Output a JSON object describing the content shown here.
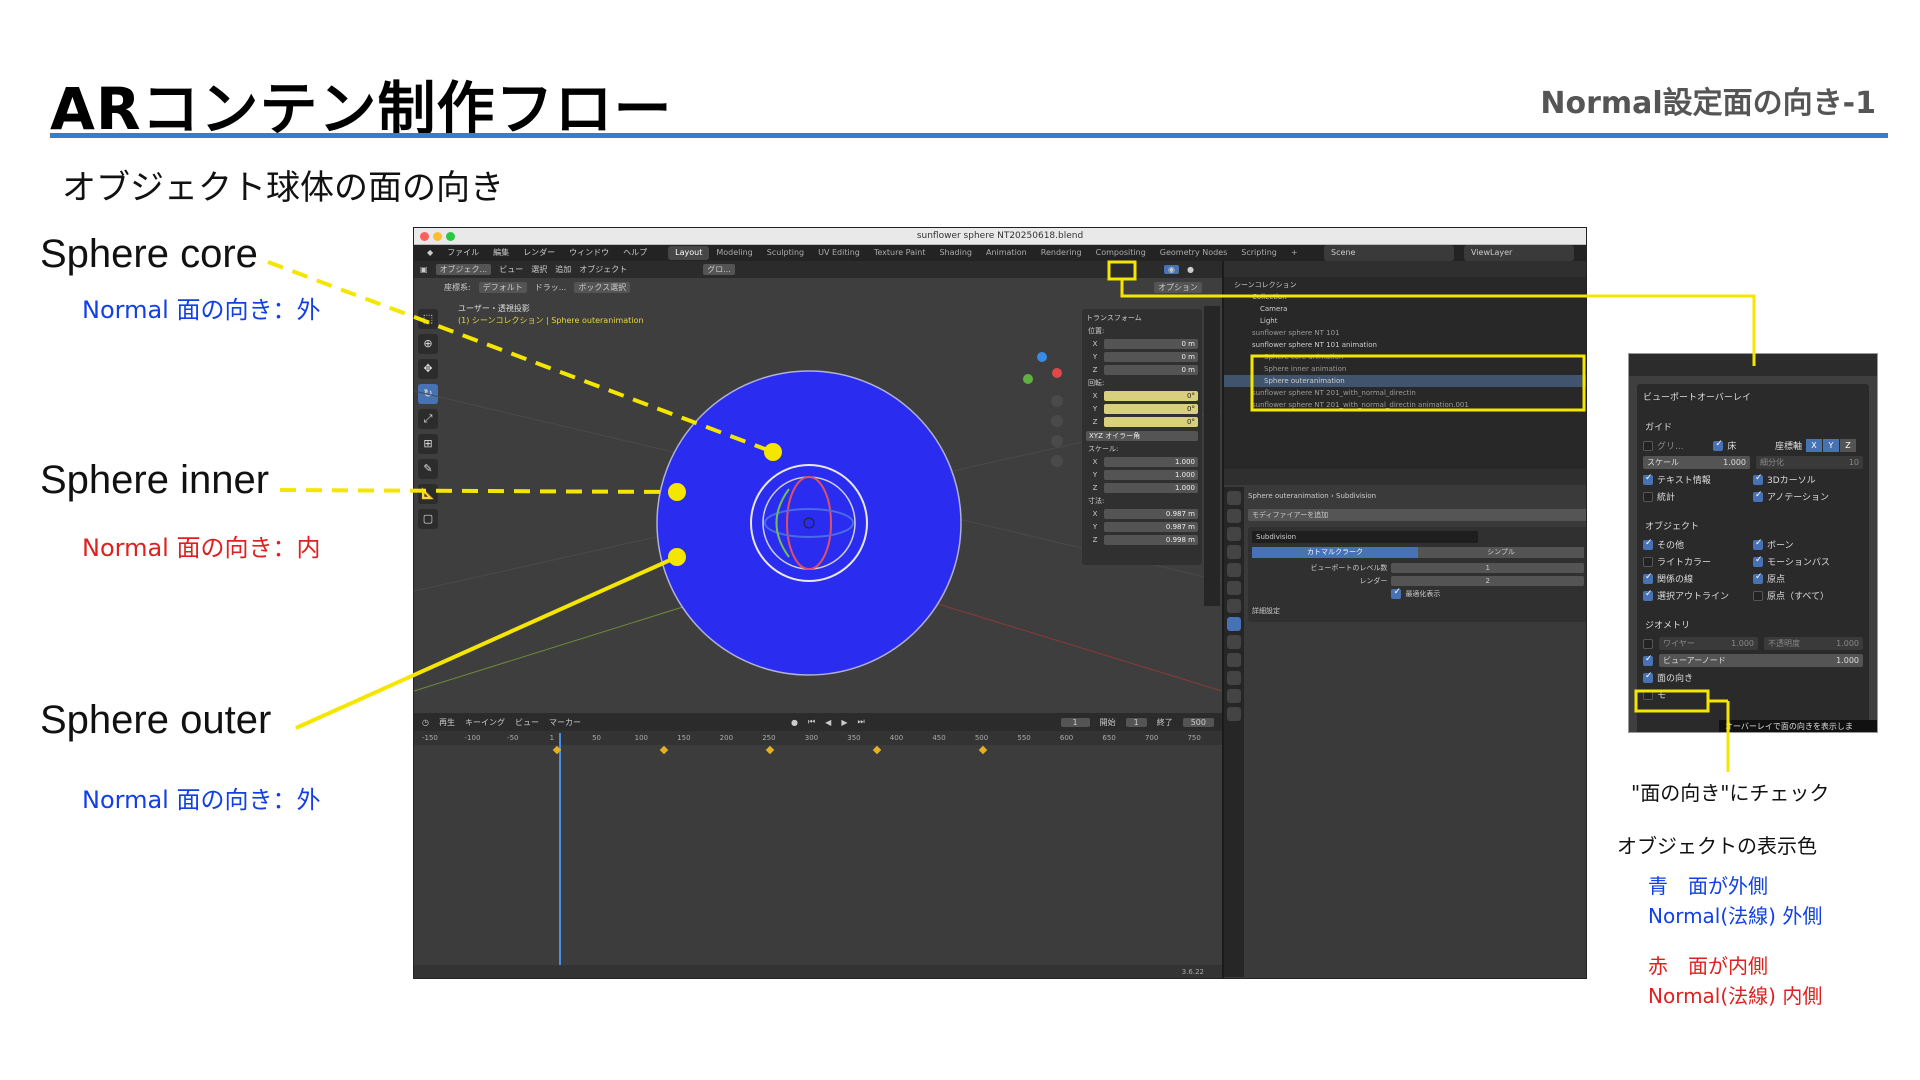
{
  "slide": {
    "title": "ARコンテン制作フロー",
    "subtitle": "Normal設定面の向き-1",
    "section_heading": "オブジェクト球体の面の向き"
  },
  "callouts": [
    {
      "title": "Sphere core",
      "note": "Normal 面の向き：外",
      "color": "#1240e6"
    },
    {
      "title": "Sphere inner",
      "note": "Normal 面の向き：内",
      "color": "#e02020"
    },
    {
      "title": "Sphere outer",
      "note": "Normal 面の向き：外",
      "color": "#1240e6"
    }
  ],
  "blender": {
    "window_title": "sunflower sphere NT20250618.blend",
    "menu": [
      "ファイル",
      "編集",
      "レンダー",
      "ウィンドウ",
      "ヘルプ"
    ],
    "workspaces": [
      "Layout",
      "Modeling",
      "Sculpting",
      "UV Editing",
      "Texture Paint",
      "Shading",
      "Animation",
      "Rendering",
      "Compositing",
      "Geometry Nodes",
      "Scripting"
    ],
    "scene": "Scene",
    "view_layer": "ViewLayer",
    "viewport": {
      "mode": "オブジェク...",
      "header_items": [
        "ビュー",
        "選択",
        "追加",
        "オブジェクト"
      ],
      "orientation": "グロ...",
      "coord_label": "座標系:",
      "coord_value": "デフォルト",
      "drag": "ドラッ...",
      "select_mode": "ボックス選択",
      "options": "オプション",
      "view_name": "ユーザー・透視投影",
      "collection_path": "(1) シーンコレクション | Sphere outeranimation"
    },
    "transform_panel": {
      "title": "トランスフォーム",
      "location_label": "位置:",
      "location": [
        "0 m",
        "0 m",
        "0 m"
      ],
      "rotation_label": "回転:",
      "rotation": [
        "0°",
        "0°",
        "0°"
      ],
      "rotation_mode": "XYZ オイラー角",
      "scale_label": "スケール:",
      "scale": [
        "1.000",
        "1.000",
        "1.000"
      ],
      "dimensions_label": "寸法:",
      "dimensions": [
        "0.987 m",
        "0.987 m",
        "0.998 m"
      ],
      "axes": [
        "X",
        "Y",
        "Z"
      ]
    },
    "timeline": {
      "playback": "再生",
      "keying": "キーイング",
      "view": "ビュー",
      "marker": "マーカー",
      "current_frame": "1",
      "start_label": "開始",
      "start": "1",
      "end_label": "終了",
      "end": "500",
      "frame_labels": [
        "-150",
        "-100",
        "-50",
        "1",
        "50",
        "100",
        "150",
        "200",
        "250",
        "300",
        "350",
        "400",
        "450",
        "500",
        "550",
        "600",
        "650",
        "700",
        "750"
      ],
      "version": "3.6.22"
    },
    "outliner": {
      "root": "シーンコレクション",
      "rows": [
        "Collection",
        "Camera",
        "Light",
        "sunflower sphere NT 101",
        "sunflower sphere NT 101 animation",
        "Sphere core animation",
        "Sphere inner animation",
        "Sphere outeranimation",
        "sunflower sphere NT 201_with_normal_directin",
        "sunflower sphere NT 201_with_normal_directin animation.001"
      ]
    },
    "properties": {
      "object": "Sphere outeranimation",
      "modifier_crumb": "Subdivision",
      "add_modifier": "モディファイアーを追加",
      "modifier_name": "Subdivision",
      "mode_a": "カトマルクラーク",
      "mode_b": "シンプル",
      "levels_viewport_label": "ビューポートのレベル数",
      "levels_viewport": "1",
      "render_label": "レンダー",
      "render": "2",
      "optimal_display": "最適化表示",
      "advanced": "詳細設定"
    }
  },
  "overlay_popup": {
    "title": "ビューポートオーバーレイ",
    "guides": "ガイド",
    "grid": "グリ...",
    "floor": "床",
    "axes_label": "座標軸",
    "axes": [
      "X",
      "Y",
      "Z"
    ],
    "scale_label": "スケール",
    "scale_value": "1.000",
    "subdivision_label": "細分化",
    "subdivision_value": "10",
    "text_info": "テキスト情報",
    "cursor_3d": "3Dカーソル",
    "statistics": "統計",
    "annotations": "アノテーション",
    "objects": "オブジェクト",
    "extras": "その他",
    "bones": "ボーン",
    "light_colors": "ライトカラー",
    "motion_paths": "モーションパス",
    "relations": "関係の線",
    "origins": "原点",
    "outline_selected": "選択アウトライン",
    "origins_all": "原点（すべて）",
    "geometry": "ジオメトリ",
    "wireframe": "ワイヤー",
    "wireframe_value": "1.000",
    "opacity": "不透明度",
    "opacity_value": "1.000",
    "viewer_node": "ビューアーノード",
    "viewer_node_value": "1.000",
    "face_orientation": "面の向き",
    "tooltip": "オーバーレイで面の向きを表示しま",
    "cut_label": "モ"
  },
  "check_note": "\"面の向き\"にチェック",
  "legend": {
    "heading": "オブジェクトの表示色",
    "blue_line1": "青　面が外側",
    "blue_line2": "Normal(法線) 外側",
    "red_line1": "赤　面が内側",
    "red_line2": "Normal(法線) 内側",
    "blue": "#1240e6",
    "red": "#e02020"
  },
  "colors": {
    "accent_rule": "#2f7fd6",
    "annotation_yellow": "#f5e600",
    "sphere_blue": "#2a2df0",
    "blender_select": "#4772b3"
  }
}
